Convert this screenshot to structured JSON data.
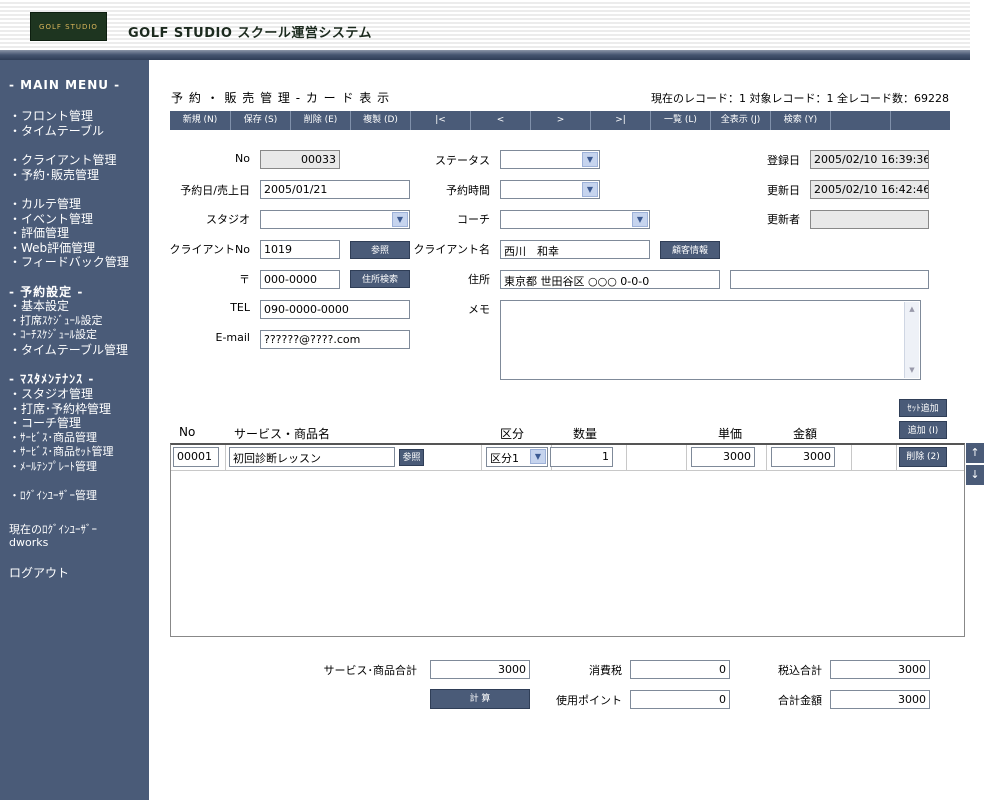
{
  "header": {
    "logo_text": "GOLF STUDIO",
    "app_title": "GOLF STUDIO スクール運営システム"
  },
  "sidebar": {
    "main_menu_title": "- MAIN MENU -",
    "group1": [
      "・フロント管理",
      "・タイムテーブル"
    ],
    "group2": [
      "・クライアント管理",
      "・予約･販売管理"
    ],
    "group3": [
      "・カルテ管理",
      "・イベント管理",
      "・評価管理",
      "・Web評価管理",
      "・フィードバック管理"
    ],
    "reservation_settings_title": "- 予約設定 -",
    "group4": [
      "・基本設定",
      "・打席ｽｹｼﾞｭｰﾙ設定",
      "・ｺｰﾁｽｹｼﾞｭｰﾙ設定",
      "・タイムテーブル管理"
    ],
    "master_title": "- ﾏｽﾀﾒﾝﾃﾅﾝｽ -",
    "group5": [
      "・スタジオ管理",
      "・打席･予約枠管理",
      "・コーチ管理",
      "・ｻｰﾋﾞｽ･商品管理",
      "・ｻｰﾋﾞｽ･商品ｾｯﾄ管理",
      "・ﾒｰﾙﾃﾝﾌﾟﾚｰﾄ管理"
    ],
    "login_user_mgmt": "・ﾛｸﾞｲﾝﾕｰｻﾞｰ管理",
    "current_user_label": "現在のﾛｸﾞｲﾝﾕｰｻﾞｰ",
    "current_user": "dworks",
    "logout": "ログアウト"
  },
  "page": {
    "title": "予 約 ・ 販 売 管 理 - カ ー ド 表 示",
    "record_info": "現在のレコード：1  対象レコード：1  全レコード数：69228"
  },
  "toolbar": [
    "新規 (N)",
    "保存 (S)",
    "削除 (E)",
    "複製 (D)",
    "|<",
    "<",
    ">",
    ">|",
    "一覧 (L)",
    "全表示 (J)",
    "検索 (Y)",
    ""
  ],
  "form": {
    "no_label": "No",
    "no_value": "00033",
    "status_label": "ステータス",
    "status_value": "",
    "reg_date_label": "登録日",
    "reg_date_value": "2005/02/10 16:39:36",
    "reserve_date_label": "予約日/売上日",
    "reserve_date_value": "2005/01/21",
    "reserve_time_label": "予約時間",
    "reserve_time_value": "",
    "upd_date_label": "更新日",
    "upd_date_value": "2005/02/10 16:42:46",
    "studio_label": "スタジオ",
    "studio_value": "",
    "coach_label": "コーチ",
    "coach_value": "",
    "updater_label": "更新者",
    "updater_value": "",
    "client_no_label": "クライアントNo",
    "client_no_value": "1019",
    "ref_button": "参照",
    "client_name_label": "クライアント名",
    "client_name_value": "西川　和幸",
    "customer_info_button": "顧客情報",
    "zip_label": "〒",
    "zip_value": "000-0000",
    "address_search_button": "住所検索",
    "address_label": "住所",
    "address_value": "東京都 世田谷区 ○○○ 0-0-0",
    "address2_value": "",
    "tel_label": "TEL",
    "tel_value": "090-0000-0000",
    "memo_label": "メモ",
    "memo_value": "",
    "email_label": "E-mail",
    "email_value": "??????@????.com"
  },
  "items": {
    "set_add_button": "ｾｯﾄ追加",
    "add_button": "追加 (I)",
    "headers": {
      "no": "No",
      "name": "サービス・商品名",
      "category": "区分",
      "qty": "数量",
      "unit_price": "単価",
      "amount": "金額"
    },
    "rows": [
      {
        "no": "00001",
        "name": "初回診断レッスン",
        "ref": "参照",
        "category": "区分1",
        "qty": "1",
        "unit_price": "3000",
        "amount": "3000",
        "delete": "削除 (2)"
      }
    ],
    "up_arrow": "↑",
    "down_arrow": "↓"
  },
  "totals": {
    "service_total_label": "サービス･商品合計",
    "service_total": "3000",
    "tax_label": "消費税",
    "tax": "0",
    "tax_incl_label": "税込合計",
    "tax_incl": "3000",
    "calc_button": "計 算",
    "points_label": "使用ポイント",
    "points": "0",
    "grand_total_label": "合計金額",
    "grand_total": "3000"
  }
}
